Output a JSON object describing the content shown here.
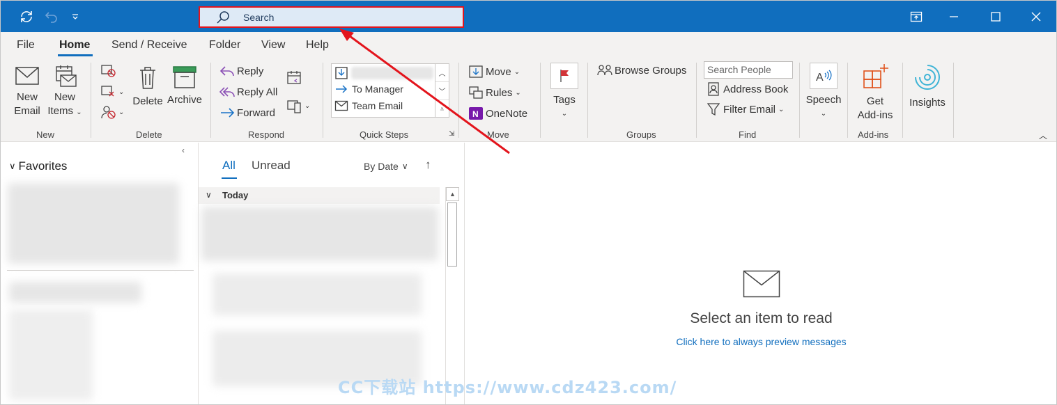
{
  "titlebar": {
    "search_placeholder": "Search"
  },
  "menu": {
    "tabs": [
      {
        "label": "File"
      },
      {
        "label": "Home"
      },
      {
        "label": "Send / Receive"
      },
      {
        "label": "Folder"
      },
      {
        "label": "View"
      },
      {
        "label": "Help"
      }
    ],
    "active": "Home"
  },
  "ribbon": {
    "new": {
      "new_email": [
        "New",
        "Email"
      ],
      "new_items": [
        "New",
        "Items"
      ],
      "group": "New"
    },
    "delete": {
      "delete_label": "Delete",
      "archive_label": "Archive",
      "group": "Delete"
    },
    "respond": {
      "reply": "Reply",
      "reply_all": "Reply All",
      "forward": "Forward",
      "group": "Respond"
    },
    "quick_steps": {
      "items": [
        "To Manager",
        "Team Email"
      ],
      "group": "Quick Steps"
    },
    "move": {
      "move": "Move",
      "rules": "Rules",
      "onenote": "OneNote",
      "group": "Move"
    },
    "tags": {
      "label": "Tags"
    },
    "groups": {
      "browse": "Browse Groups",
      "group": "Groups"
    },
    "find": {
      "search_people_placeholder": "Search People",
      "address_book": "Address Book",
      "filter_email": "Filter Email",
      "group": "Find"
    },
    "speech": {
      "label": "Speech"
    },
    "addins": {
      "get": [
        "Get",
        "Add-ins"
      ],
      "group": "Add-ins"
    },
    "insights": {
      "label": "Insights"
    }
  },
  "folders": {
    "favorites": "Favorites"
  },
  "list": {
    "tabs": [
      "All",
      "Unread"
    ],
    "sort": "By Date",
    "section": "Today"
  },
  "reading": {
    "empty_title": "Select an item to read",
    "preview_link": "Click here to always preview messages"
  },
  "watermark": "CC下载站 https://www.cdz423.com/",
  "colors": {
    "titlebar": "#106ebe",
    "accent": "#106ebe",
    "highlight": "#e3141c"
  }
}
